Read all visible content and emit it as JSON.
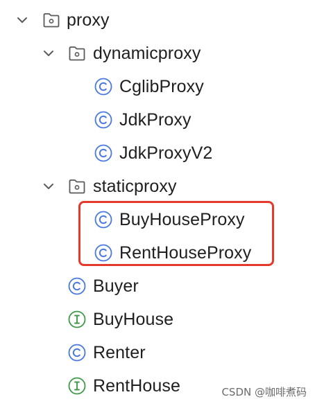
{
  "tree": {
    "items": [
      {
        "kind": "folder",
        "label": "proxy",
        "expanded": true,
        "icon": "folder-icon"
      },
      {
        "kind": "folder",
        "label": "dynamicproxy",
        "expanded": true,
        "icon": "folder-icon"
      },
      {
        "kind": "class",
        "label": "CglibProxy",
        "icon": "class-icon"
      },
      {
        "kind": "class",
        "label": "JdkProxy",
        "icon": "class-icon"
      },
      {
        "kind": "class",
        "label": "JdkProxyV2",
        "icon": "class-icon"
      },
      {
        "kind": "folder",
        "label": "staticproxy",
        "expanded": true,
        "icon": "folder-icon"
      },
      {
        "kind": "class",
        "label": "BuyHouseProxy",
        "icon": "class-icon"
      },
      {
        "kind": "class",
        "label": "RentHouseProxy",
        "icon": "class-icon"
      },
      {
        "kind": "class",
        "label": "Buyer",
        "icon": "class-icon"
      },
      {
        "kind": "interface",
        "label": "BuyHouse",
        "icon": "interface-icon"
      },
      {
        "kind": "class",
        "label": "Renter",
        "icon": "class-icon"
      },
      {
        "kind": "interface",
        "label": "RentHouse",
        "icon": "interface-icon"
      }
    ]
  },
  "colors": {
    "class_icon": "#4a77e0",
    "interface_icon": "#3f9a4a",
    "folder_icon": "#5a5a5a",
    "highlight_border": "#e4392b",
    "text": "#1f1f1f"
  },
  "watermark": "CSDN @咖啡煮码"
}
